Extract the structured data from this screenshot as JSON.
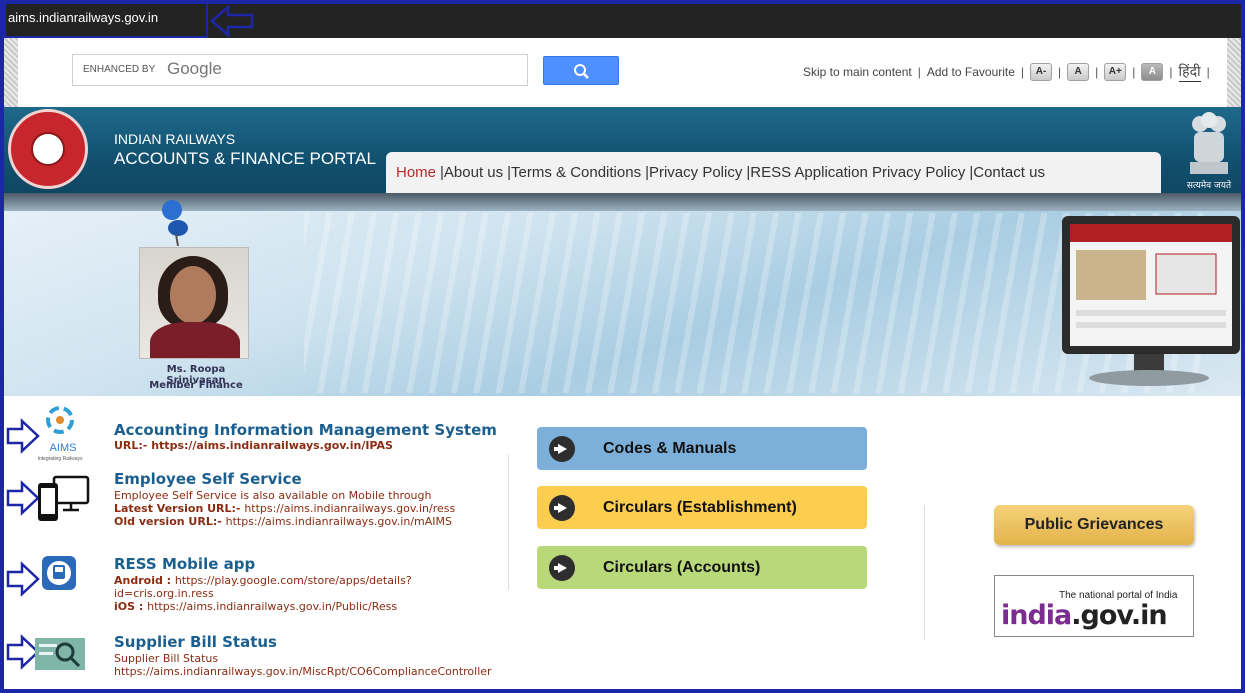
{
  "url": "aims.indianrailways.gov.in",
  "search": {
    "enhanced": "ENHANCED BY",
    "google": "Google"
  },
  "toplinks": {
    "skip": "Skip to main content",
    "favourite": "Add to Favourite",
    "font_minus": "A-",
    "font_normal": "A",
    "font_plus": "A+",
    "contrast": "A",
    "hindi": "हिंदी"
  },
  "header": {
    "line1": "INDIAN RAILWAYS",
    "line2": "ACCOUNTS & FINANCE PORTAL",
    "emblem_text": "सत्यमेव जयते"
  },
  "nav": [
    "Home",
    "|About us",
    "|Terms & Conditions",
    "|Privacy Policy",
    "|RESS Application Privacy Policy",
    "|Contact us"
  ],
  "banner": {
    "member_name": "Ms. Roopa Srinivasan",
    "member_role": "Member Finance"
  },
  "sections": {
    "aims": {
      "title": "Accounting Information Management System",
      "url_label": "URL:- ",
      "url": "https://aims.indianrailways.gov.in/IPAS",
      "logo_text": "AIMS",
      "logo_sub": "Integrating Railways"
    },
    "ess": {
      "title": "Employee Self Service",
      "line1": "Employee Self Service is also available on Mobile through",
      "latest_label": "Latest Version URL:- ",
      "latest_url": "https://aims.indianrailways.gov.in/ress",
      "old_label": "Old version URL:- ",
      "old_url": "https://aims.indianrailways.gov.in/mAIMS"
    },
    "ress": {
      "title": "RESS Mobile app",
      "android_label": "Android : ",
      "android_url": "https://play.google.com/store/apps/details?",
      "android_url2": "id=cris.org.in.ress",
      "ios_label": "iOS : ",
      "ios_url": "https://aims.indianrailways.gov.in/Public/Ress"
    },
    "supplier": {
      "title": "Supplier Bill Status",
      "line1": "Supplier Bill Status",
      "url": "https://aims.indianrailways.gov.in/MiscRpt/CO6ComplianceController"
    }
  },
  "buttons": {
    "codes": "Codes & Manuals",
    "circ_est": "Circulars (Establishment)",
    "circ_acc": "Circulars (Accounts)",
    "grievances": "Public Grievances"
  },
  "indiagov": {
    "tagline": "The national portal of India",
    "india": "india",
    "rest": ".gov.in"
  },
  "colors": {
    "accent_border": "#1c27a8",
    "header": "#12506f",
    "btn_blue": "#7cb0da",
    "btn_yellow": "#fccd4f",
    "btn_green": "#b9d87a"
  }
}
